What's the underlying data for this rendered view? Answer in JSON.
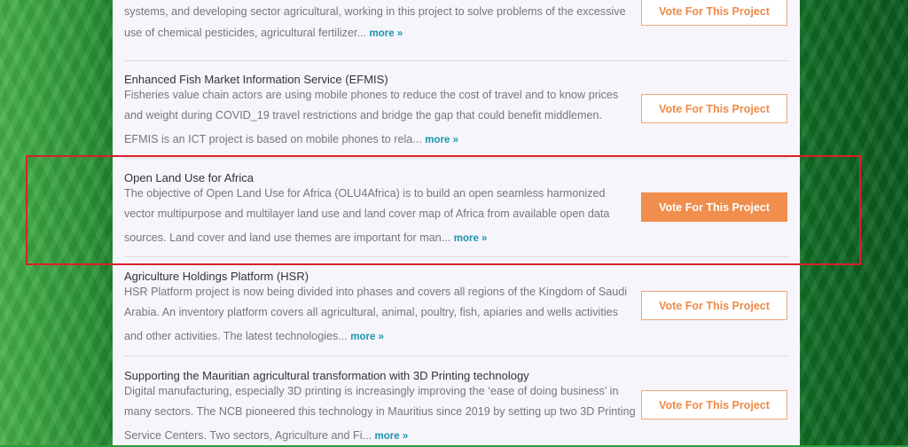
{
  "projects": [
    {
      "title": "",
      "lines": [
        "systems, and developing sector agricultural, working in this project to solve problems of the excessive"
      ],
      "last_line": "use of chemical pesticides, agricultural fertilizer...",
      "more": "more »",
      "vote": "Vote For This Project",
      "active": false
    },
    {
      "title": "Enhanced Fish Market Information Service (EFMIS)",
      "lines": [
        "Fisheries value chain actors are using mobile phones to reduce the cost of travel and to know prices",
        "and weight during COVID_19 travel restrictions and bridge the gap that could benefit middlemen."
      ],
      "last_line": "EFMIS is an ICT project is based on mobile phones to rela...",
      "more": "more »",
      "vote": "Vote For This Project",
      "active": false
    },
    {
      "title": "Open Land Use for Africa",
      "lines": [
        "The objective of Open Land Use for Africa (OLU4Africa) is to build an open seamless harmonized",
        "vector multipurpose and multilayer land use and land cover map of Africa from available open data"
      ],
      "last_line": "sources. Land cover and land use themes are important for man...",
      "more": "more »",
      "vote": "Vote For This Project",
      "active": true
    },
    {
      "title": "Agriculture Holdings Platform (HSR)",
      "lines": [
        "HSR Platform project is now being divided into phases and covers all regions of the Kingdom of Saudi",
        "Arabia. An inventory platform covers all agricultural, animal, poultry, fish, apiaries and wells activities"
      ],
      "last_line": "and other activities. The latest technologies...",
      "more": "more »",
      "vote": "Vote For This Project",
      "active": false
    },
    {
      "title": "Supporting the Mauritian agricultural transformation with 3D Printing technology",
      "lines": [
        "Digital manufacturing, especially 3D printing is increasingly improving the ‘ease of doing business’ in",
        "many sectors. The NCB pioneered this technology in Mauritius since 2019 by setting up two 3D Printing"
      ],
      "last_line": "Service Centers. Two sectors, Agriculture and Fi...",
      "more": "more »",
      "vote": "Vote For This Project",
      "active": false
    }
  ]
}
